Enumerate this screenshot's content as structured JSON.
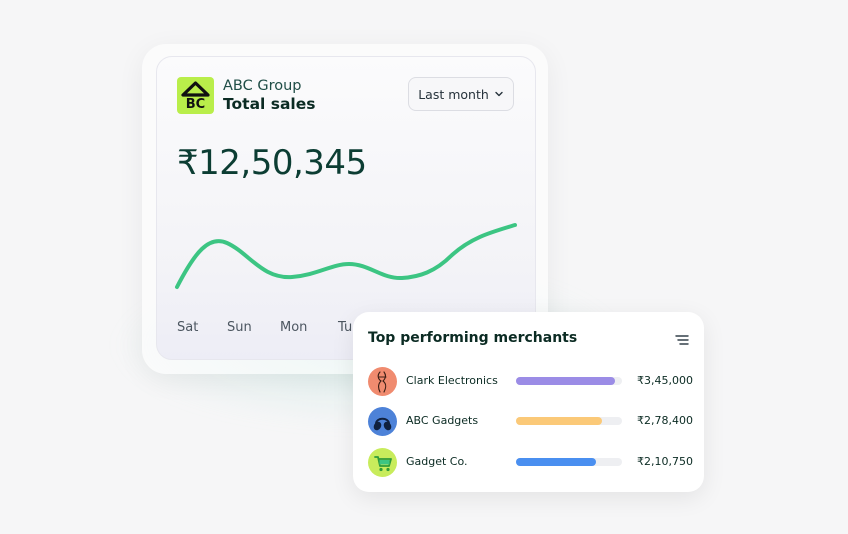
{
  "sales_card": {
    "brand_name": "ABC Group",
    "subtitle": "Total sales",
    "logo_icon": "abc-logo",
    "logo_color": "#b9ee4a",
    "period_label": "Last month",
    "total": "₹12,50,345",
    "line_color": "#3cc583",
    "days": [
      "Sat",
      "Sun",
      "Mon",
      "Tu"
    ]
  },
  "merchants": {
    "title": "Top performing merchants",
    "items": [
      {
        "name": "Clark Electronics",
        "amount": "₹3,45,000",
        "share": 0.93,
        "bar_color": "#9b8ce6",
        "avatar_icon": "electronics-figure-icon",
        "avatar_color": "#f08b6f"
      },
      {
        "name": "ABC Gadgets",
        "amount": "₹2,78,400",
        "share": 0.81,
        "bar_color": "#fbc978",
        "avatar_icon": "headphones-icon",
        "avatar_color": "#4d82d8"
      },
      {
        "name": "Gadget Co.",
        "amount": "₹2,10,750",
        "share": 0.75,
        "bar_color": "#4a8ff0",
        "avatar_icon": "shopping-cart-icon",
        "avatar_color": "#c8ec5c"
      }
    ]
  }
}
